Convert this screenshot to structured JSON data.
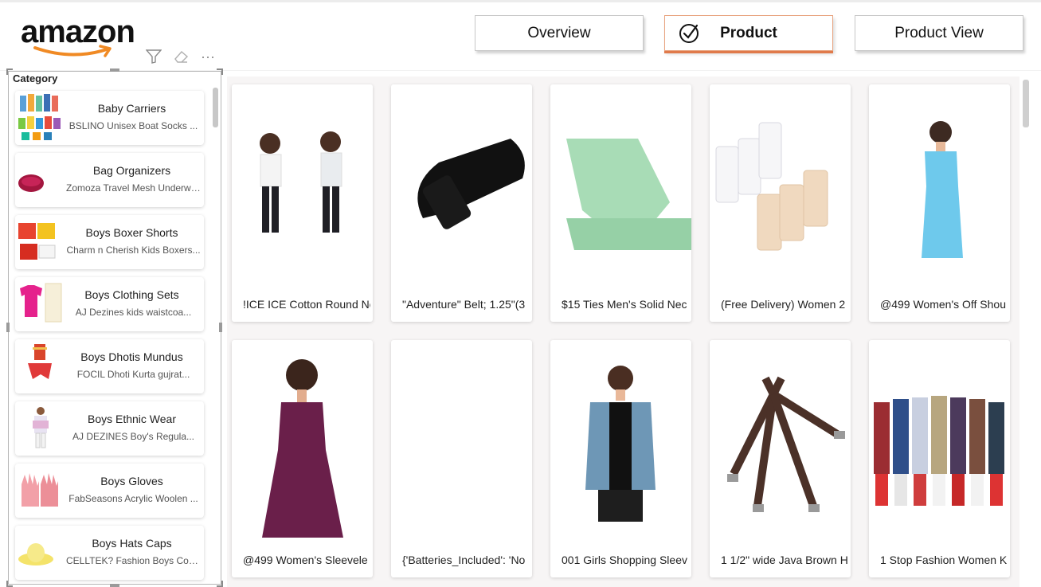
{
  "brand": {
    "logo_text": "amazon"
  },
  "toolbar": {
    "icons": [
      "filter-icon",
      "eraser-icon",
      "more-options-icon"
    ],
    "more_glyph": "···"
  },
  "nav": {
    "overview_label": "Overview",
    "product_label": "Product",
    "product_view_label": "Product View",
    "active": "Product",
    "accent_color": "#e07a4b"
  },
  "slicer": {
    "title": "Category",
    "items": [
      {
        "name": "Baby Carriers",
        "sub": "BSLINO Unisex Boat Socks ..."
      },
      {
        "name": "Bag Organizers",
        "sub": "Zomoza Travel Mesh Underwea..."
      },
      {
        "name": "Boys Boxer Shorts",
        "sub": "Charm n Cherish Kids Boxers..."
      },
      {
        "name": "Boys Clothing Sets",
        "sub": "AJ Dezines kids waistcoa..."
      },
      {
        "name": "Boys Dhotis Mundus",
        "sub": "FOCIL Dhoti Kurta gujrat..."
      },
      {
        "name": "Boys Ethnic Wear",
        "sub": "AJ DEZINES Boy's Regula..."
      },
      {
        "name": "Boys Gloves",
        "sub": "FabSeasons Acrylic Woolen ..."
      },
      {
        "name": "Boys Hats Caps",
        "sub": "CELLTEK? Fashion Boys Cool B..."
      }
    ]
  },
  "products": [
    {
      "title": "!ICE ICE Cotton Round Ne"
    },
    {
      "title": "\"Adventure\" Belt; 1.25\"(3"
    },
    {
      "title": "$15 Ties Men's Solid Nec"
    },
    {
      "title": "(Free Delivery) Women 2"
    },
    {
      "title": "@499 Women's Off Shou"
    },
    {
      "title": "@499 Women's Sleevele"
    },
    {
      "title": "{'Batteries_Included': 'No"
    },
    {
      "title": "001 Girls Shopping Sleev"
    },
    {
      "title": "1 1/2\" wide Java Brown H"
    },
    {
      "title": "1 Stop Fashion Women K"
    }
  ]
}
